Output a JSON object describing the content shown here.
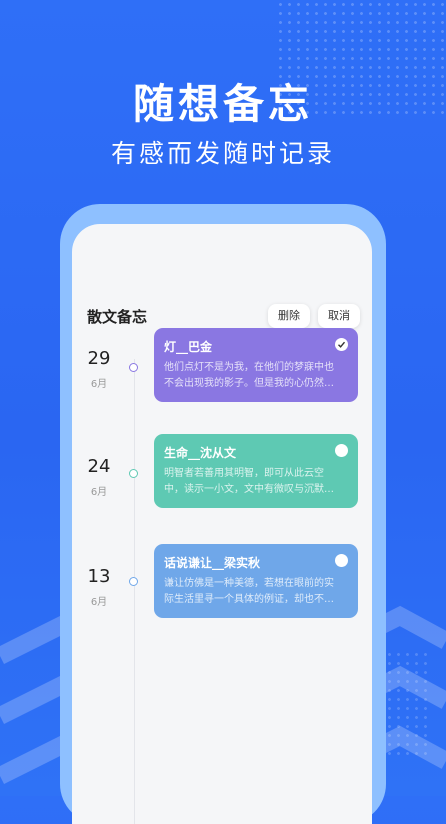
{
  "banner": {
    "headline": "随想备忘",
    "subline": "有感而发随时记录"
  },
  "app": {
    "title": "散文备忘",
    "delete_label": "删除",
    "cancel_label": "取消"
  },
  "entries": [
    {
      "day": "29",
      "month": "6月",
      "title": "灯__巴金",
      "preview": "他们点灯不是为我，在他们的梦寐中也不会出现我的影子。但是我的心仍然…",
      "color": "#8a77e2",
      "checked": true
    },
    {
      "day": "24",
      "month": "6月",
      "title": "生命__沈从文",
      "preview": "明智者若善用其明智，即可从此云空中，读示一小文，文中有微叹与沉默…",
      "color": "#5ec9b3",
      "checked": false
    },
    {
      "day": "13",
      "month": "6月",
      "title": "话说谦让__梁实秋",
      "preview": "谦让仿佛是一种美德，若想在眼前的实际生活里寻一个具体的例证，却也不…",
      "color": "#6fa7e9",
      "checked": false
    }
  ],
  "colors": {
    "background": "#2f6ff7",
    "phone_frame": "#8ec0ff",
    "screen": "#f5f6f8"
  }
}
